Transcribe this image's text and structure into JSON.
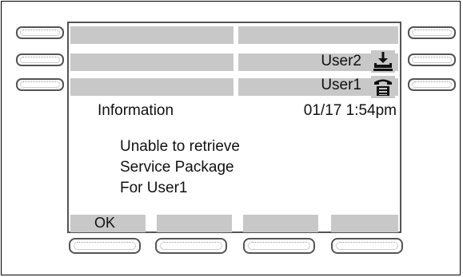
{
  "lines": [
    {
      "label": "",
      "icon": "none"
    },
    {
      "label": "User2",
      "icon": "handset-down-arrow-icon"
    },
    {
      "label": "User1",
      "icon": "phone-icon"
    }
  ],
  "status": {
    "title": "Information",
    "datetime": "01/17 1:54pm"
  },
  "message": {
    "line1": "Unable to retrieve",
    "line2": "Service Package",
    "line3": "For User1"
  },
  "softkeys": [
    "OK",
    "",
    "",
    ""
  ]
}
